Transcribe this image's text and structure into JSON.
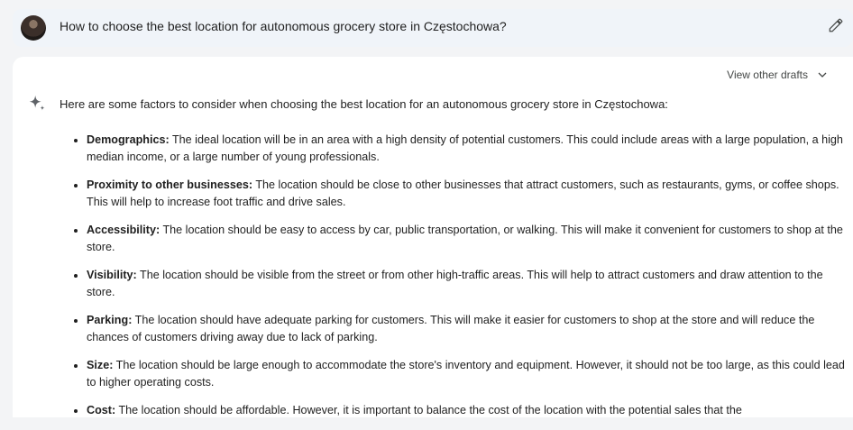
{
  "prompt": {
    "text": "How to choose the best location for autonomous grocery store in Częstochowa?",
    "edit_icon": "pencil-icon"
  },
  "response": {
    "drafts_label": "View other drafts",
    "intro": "Here are some factors to consider when choosing the best location for an autonomous grocery store in Częstochowa:",
    "items": [
      {
        "title": "Demographics:",
        "text": " The ideal location will be in an area with a high density of potential customers. This could include areas with a large population, a high median income, or a large number of young professionals."
      },
      {
        "title": "Proximity to other businesses:",
        "text": " The location should be close to other businesses that attract customers, such as restaurants, gyms, or coffee shops. This will help to increase foot traffic and drive sales."
      },
      {
        "title": "Accessibility:",
        "text": " The location should be easy to access by car, public transportation, or walking. This will make it convenient for customers to shop at the store."
      },
      {
        "title": "Visibility:",
        "text": " The location should be visible from the street or from other high-traffic areas. This will help to attract customers and draw attention to the store."
      },
      {
        "title": "Parking:",
        "text": " The location should have adequate parking for customers. This will make it easier for customers to shop at the store and will reduce the chances of customers driving away due to lack of parking."
      },
      {
        "title": "Size:",
        "text": " The location should be large enough to accommodate the store's inventory and equipment. However, it should not be too large, as this could lead to higher operating costs."
      },
      {
        "title": "Cost:",
        "text": " The location should be affordable. However, it is important to balance the cost of the location with the potential sales that the"
      }
    ]
  },
  "colors": {
    "background": "#f3f4f6",
    "prompt_bar": "#f0f4f9",
    "card": "#ffffff",
    "sparkle": "#5f6368"
  }
}
